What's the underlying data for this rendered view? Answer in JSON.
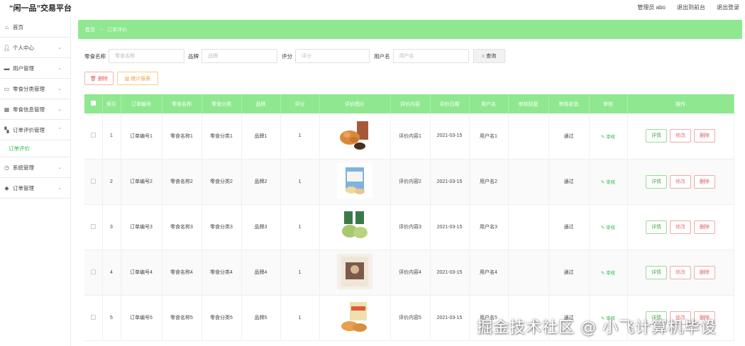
{
  "app": {
    "title": "“闲一品”交易平台"
  },
  "header": {
    "links": [
      "管理员 abo",
      "退出到前台",
      "退出登录"
    ]
  },
  "sidebar": {
    "items": [
      {
        "label": "首页",
        "icon": "home-icon",
        "chevron": false
      },
      {
        "label": "个人中心",
        "icon": "user-icon",
        "chevron": true
      },
      {
        "label": "用户管理",
        "icon": "users-icon",
        "chevron": true
      },
      {
        "label": "零食分类管理",
        "icon": "category-icon",
        "chevron": true
      },
      {
        "label": "零食信息管理",
        "icon": "info-icon",
        "chevron": true
      },
      {
        "label": "订单评价管理",
        "icon": "grid-icon",
        "chevron": true,
        "expanded": true
      },
      {
        "label": "系统管理",
        "icon": "system-icon",
        "chevron": true
      },
      {
        "label": "订单管理",
        "icon": "order-icon",
        "chevron": true
      }
    ],
    "sub_item": "订单评价"
  },
  "breadcrumb": {
    "home": "首页",
    "separator": "→",
    "current": "订单评价"
  },
  "search": {
    "fields": [
      {
        "label": "零食名称",
        "placeholder": "零食名称"
      },
      {
        "label": "品牌",
        "placeholder": "品牌"
      },
      {
        "label": "评分",
        "placeholder": "评分"
      },
      {
        "label": "用户名",
        "placeholder": "用户名"
      }
    ],
    "button": "查询"
  },
  "actions": {
    "delete": "删除",
    "stats": "统计报表"
  },
  "table": {
    "headers": [
      "",
      "索引",
      "订单编号",
      "零食名称",
      "零食分类",
      "品牌",
      "评分",
      "评价图片",
      "评价内容",
      "评价日期",
      "用户名",
      "审核回复",
      "审核状态",
      "审核",
      "操作"
    ],
    "review_label": "审核",
    "ops": {
      "detail": "详情",
      "edit": "修改",
      "delete": "删除"
    },
    "rows": [
      {
        "index": "1",
        "order_no": "订单编号1",
        "name": "零食名称1",
        "category": "零食分类1",
        "brand": "品牌1",
        "score": "1",
        "content": "评价内容1",
        "date": "2021-03-15",
        "user": "用户名1",
        "reply": "",
        "status": "通过"
      },
      {
        "index": "2",
        "order_no": "订单编号2",
        "name": "零食名称2",
        "category": "零食分类2",
        "brand": "品牌2",
        "score": "1",
        "content": "评价内容2",
        "date": "2021-03-15",
        "user": "用户名2",
        "reply": "",
        "status": "通过"
      },
      {
        "index": "3",
        "order_no": "订单编号3",
        "name": "零食名称3",
        "category": "零食分类3",
        "brand": "品牌3",
        "score": "1",
        "content": "评价内容3",
        "date": "2021-03-15",
        "user": "用户名3",
        "reply": "",
        "status": "通过"
      },
      {
        "index": "4",
        "order_no": "订单编号4",
        "name": "零食名称4",
        "category": "零食分类4",
        "brand": "品牌4",
        "score": "1",
        "content": "评价内容4",
        "date": "2021-03-15",
        "user": "用户名4",
        "reply": "",
        "status": "通过"
      },
      {
        "index": "5",
        "order_no": "订单编号5",
        "name": "零食名称5",
        "category": "零食分类5",
        "brand": "品牌5",
        "score": "1",
        "content": "评价内容5",
        "date": "2021-03-15",
        "user": "用户名5",
        "reply": "",
        "status": "通过"
      }
    ]
  },
  "watermark": "掘金技术社区 @ 小飞计算机毕设",
  "colors": {
    "accent": "#8fe88f",
    "active_text": "#37b95a",
    "danger": "#e25d5d",
    "warning": "#e6a23c"
  }
}
